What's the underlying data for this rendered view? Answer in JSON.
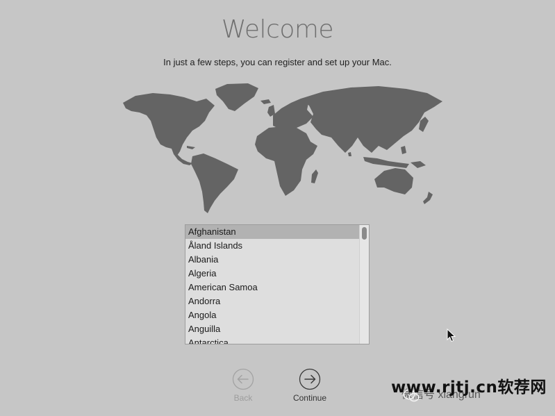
{
  "header": {
    "title": "Welcome",
    "subtitle": "In just a few steps, you can register and set up your Mac."
  },
  "country_list": {
    "selected": "Afghanistan",
    "items": [
      "Afghanistan",
      "Åland Islands",
      "Albania",
      "Algeria",
      "American Samoa",
      "Andorra",
      "Angola",
      "Anguilla",
      "Antarctica"
    ]
  },
  "navigation": {
    "back_label": "Back",
    "continue_label": "Continue",
    "back_enabled": false
  },
  "watermark": {
    "site": "www.rjtj.cn软荐网",
    "wechat": "微信号 xiangrun"
  },
  "icons": {
    "world_map": "world-map",
    "back": "arrow-left-circle-icon",
    "continue": "arrow-right-circle-icon",
    "cursor": "mouse-pointer-icon"
  },
  "colors": {
    "background": "#c6c6c6",
    "land": "#646464",
    "list_background": "#dedede",
    "selection": "#b2b2b2"
  }
}
